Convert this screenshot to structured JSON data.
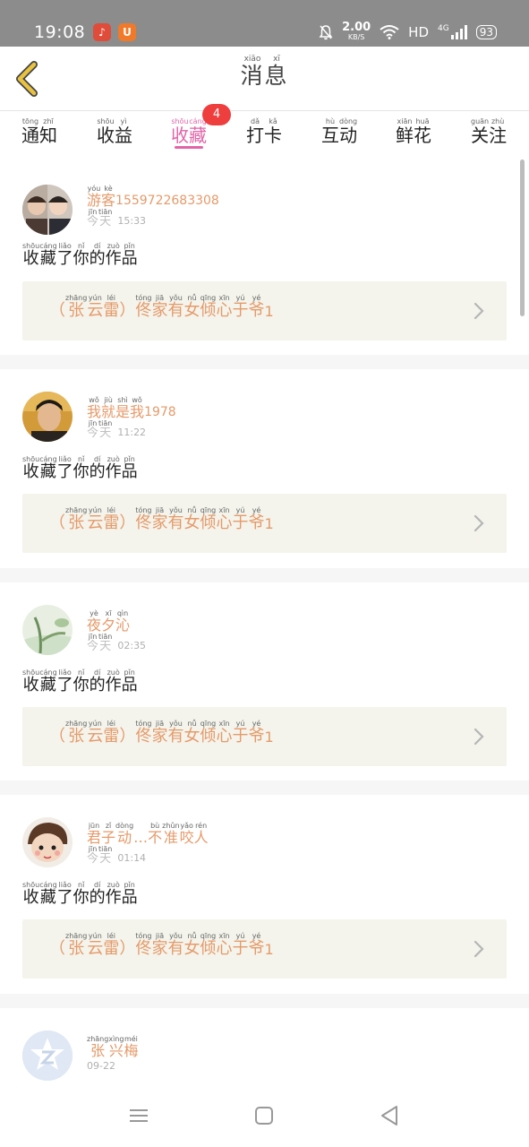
{
  "status_bar": {
    "time": "19:08",
    "net_speed_value": "2.00",
    "net_speed_unit": "KB/S",
    "hd_label": "HD",
    "signal_label": "4G",
    "battery": "93"
  },
  "header": {
    "title": [
      {
        "c": "消",
        "p": "xiāo"
      },
      {
        "c": "息",
        "p": "xī"
      }
    ]
  },
  "tabs": [
    {
      "name": "tongzhi",
      "chars": [
        {
          "c": "通",
          "p": "tōng"
        },
        {
          "c": "知",
          "p": "zhī"
        }
      ]
    },
    {
      "name": "shouyi",
      "chars": [
        {
          "c": "收",
          "p": "shōu"
        },
        {
          "c": "益",
          "p": "yì"
        }
      ]
    },
    {
      "name": "shoucang",
      "chars": [
        {
          "c": "收",
          "p": "shōu"
        },
        {
          "c": "藏",
          "p": "cáng"
        }
      ],
      "badge": "4",
      "active": true
    },
    {
      "name": "daka",
      "chars": [
        {
          "c": "打",
          "p": "dǎ"
        },
        {
          "c": "卡",
          "p": "kǎ"
        }
      ]
    },
    {
      "name": "hudong",
      "chars": [
        {
          "c": "互",
          "p": "hù"
        },
        {
          "c": "动",
          "p": "dòng"
        }
      ]
    },
    {
      "name": "xianhua",
      "chars": [
        {
          "c": "鲜",
          "p": "xiān"
        },
        {
          "c": "花",
          "p": "huā"
        }
      ]
    },
    {
      "name": "guanzhu",
      "chars": [
        {
          "c": "关",
          "p": "guān"
        },
        {
          "c": "注",
          "p": "zhù"
        }
      ]
    }
  ],
  "items": [
    {
      "name_chars": [
        {
          "c": "游",
          "p": "yóu"
        },
        {
          "c": "客",
          "p": "kè"
        }
      ],
      "name_suffix": "1559722683308",
      "date_chars": [
        {
          "c": "今",
          "p": "jīn"
        },
        {
          "c": "天",
          "p": "tiān"
        }
      ],
      "time": "15:33",
      "action_chars": [
        {
          "c": "收",
          "p": "shōu"
        },
        {
          "c": "藏",
          "p": "cáng"
        },
        {
          "c": "了",
          "p": "liǎo"
        },
        {
          "c": "你",
          "p": "nǐ"
        },
        {
          "c": "的",
          "p": "dí"
        },
        {
          "c": "作",
          "p": "zuò"
        },
        {
          "c": "品",
          "p": "pǐn"
        }
      ],
      "work_chars": [
        {
          "c": "（",
          "p": ""
        },
        {
          "c": "张",
          "p": "zhāng"
        },
        {
          "c": "云",
          "p": "yún"
        },
        {
          "c": "雷",
          "p": "léi"
        },
        {
          "c": "）",
          "p": ""
        },
        {
          "c": "佟",
          "p": "tóng"
        },
        {
          "c": "家",
          "p": "jiā"
        },
        {
          "c": "有",
          "p": "yǒu"
        },
        {
          "c": "女",
          "p": "nǚ"
        },
        {
          "c": "倾",
          "p": "qīng"
        },
        {
          "c": "心",
          "p": "xīn"
        },
        {
          "c": "于",
          "p": "yú"
        },
        {
          "c": "爷",
          "p": "yé"
        }
      ],
      "work_suffix": "1"
    },
    {
      "name_chars": [
        {
          "c": "我",
          "p": "wǒ"
        },
        {
          "c": "就",
          "p": "jiù"
        },
        {
          "c": "是",
          "p": "shì"
        },
        {
          "c": "我",
          "p": "wǒ"
        }
      ],
      "name_suffix": "1978",
      "date_chars": [
        {
          "c": "今",
          "p": "jīn"
        },
        {
          "c": "天",
          "p": "tiān"
        }
      ],
      "time": "11:22",
      "action_chars": [
        {
          "c": "收",
          "p": "shōu"
        },
        {
          "c": "藏",
          "p": "cáng"
        },
        {
          "c": "了",
          "p": "liǎo"
        },
        {
          "c": "你",
          "p": "nǐ"
        },
        {
          "c": "的",
          "p": "dí"
        },
        {
          "c": "作",
          "p": "zuò"
        },
        {
          "c": "品",
          "p": "pǐn"
        }
      ],
      "work_chars": [
        {
          "c": "（",
          "p": ""
        },
        {
          "c": "张",
          "p": "zhāng"
        },
        {
          "c": "云",
          "p": "yún"
        },
        {
          "c": "雷",
          "p": "léi"
        },
        {
          "c": "）",
          "p": ""
        },
        {
          "c": "佟",
          "p": "tóng"
        },
        {
          "c": "家",
          "p": "jiā"
        },
        {
          "c": "有",
          "p": "yǒu"
        },
        {
          "c": "女",
          "p": "nǚ"
        },
        {
          "c": "倾",
          "p": "qīng"
        },
        {
          "c": "心",
          "p": "xīn"
        },
        {
          "c": "于",
          "p": "yú"
        },
        {
          "c": "爷",
          "p": "yé"
        }
      ],
      "work_suffix": "1"
    },
    {
      "name_chars": [
        {
          "c": "夜",
          "p": "yè"
        },
        {
          "c": "夕",
          "p": "xī"
        },
        {
          "c": "沁",
          "p": "qìn"
        }
      ],
      "name_suffix": "",
      "date_chars": [
        {
          "c": "今",
          "p": "jīn"
        },
        {
          "c": "天",
          "p": "tiān"
        }
      ],
      "time": "02:35",
      "action_chars": [
        {
          "c": "收",
          "p": "shōu"
        },
        {
          "c": "藏",
          "p": "cáng"
        },
        {
          "c": "了",
          "p": "liǎo"
        },
        {
          "c": "你",
          "p": "nǐ"
        },
        {
          "c": "的",
          "p": "dí"
        },
        {
          "c": "作",
          "p": "zuò"
        },
        {
          "c": "品",
          "p": "pǐn"
        }
      ],
      "work_chars": [
        {
          "c": "（",
          "p": ""
        },
        {
          "c": "张",
          "p": "zhāng"
        },
        {
          "c": "云",
          "p": "yún"
        },
        {
          "c": "雷",
          "p": "léi"
        },
        {
          "c": "）",
          "p": ""
        },
        {
          "c": "佟",
          "p": "tóng"
        },
        {
          "c": "家",
          "p": "jiā"
        },
        {
          "c": "有",
          "p": "yǒu"
        },
        {
          "c": "女",
          "p": "nǚ"
        },
        {
          "c": "倾",
          "p": "qīng"
        },
        {
          "c": "心",
          "p": "xīn"
        },
        {
          "c": "于",
          "p": "yú"
        },
        {
          "c": "爷",
          "p": "yé"
        }
      ],
      "work_suffix": "1"
    },
    {
      "name_chars": [
        {
          "c": "君",
          "p": "jūn"
        },
        {
          "c": "子",
          "p": "zǐ"
        },
        {
          "c": "动",
          "p": "dòng"
        },
        {
          "c": "…",
          "p": ""
        },
        {
          "c": "不",
          "p": "bù"
        },
        {
          "c": "准",
          "p": "zhǔn"
        },
        {
          "c": "咬",
          "p": "yǎo"
        },
        {
          "c": "人",
          "p": "rén"
        }
      ],
      "name_suffix": "",
      "date_chars": [
        {
          "c": "今",
          "p": "jīn"
        },
        {
          "c": "天",
          "p": "tiān"
        }
      ],
      "time": "01:14",
      "action_chars": [
        {
          "c": "收",
          "p": "shōu"
        },
        {
          "c": "藏",
          "p": "cáng"
        },
        {
          "c": "了",
          "p": "liǎo"
        },
        {
          "c": "你",
          "p": "nǐ"
        },
        {
          "c": "的",
          "p": "dí"
        },
        {
          "c": "作",
          "p": "zuò"
        },
        {
          "c": "品",
          "p": "pǐn"
        }
      ],
      "work_chars": [
        {
          "c": "（",
          "p": ""
        },
        {
          "c": "张",
          "p": "zhāng"
        },
        {
          "c": "云",
          "p": "yún"
        },
        {
          "c": "雷",
          "p": "léi"
        },
        {
          "c": "）",
          "p": ""
        },
        {
          "c": "佟",
          "p": "tóng"
        },
        {
          "c": "家",
          "p": "jiā"
        },
        {
          "c": "有",
          "p": "yǒu"
        },
        {
          "c": "女",
          "p": "nǚ"
        },
        {
          "c": "倾",
          "p": "qīng"
        },
        {
          "c": "心",
          "p": "xīn"
        },
        {
          "c": "于",
          "p": "yú"
        },
        {
          "c": "爷",
          "p": "yé"
        }
      ],
      "work_suffix": "1"
    },
    {
      "name_chars": [
        {
          "c": "张",
          "p": "zhāng"
        },
        {
          "c": "兴",
          "p": "xìng"
        },
        {
          "c": "梅",
          "p": "méi"
        }
      ],
      "name_suffix": "",
      "date_plain": "09-22"
    }
  ],
  "colors": {
    "accent_pink": "#e264a8",
    "name_orange": "#e59a6a",
    "badge_red": "#ee3e3e",
    "back_arrow": "#e8c240"
  },
  "icons": {
    "back": "chevron-left-icon",
    "work_arrow": "chevron-right-icon",
    "nav_menu": "menu-icon",
    "nav_home": "home-square-icon",
    "nav_back": "triangle-back-icon"
  }
}
